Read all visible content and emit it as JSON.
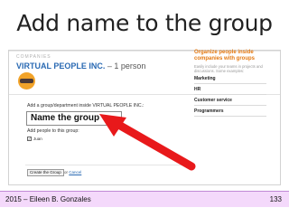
{
  "slide": {
    "title": "Add name to the group",
    "footer_left": "2015 – Eileen B. Gonzales",
    "footer_right": "133"
  },
  "screen": {
    "companies_label": "COMPANIES",
    "company_name": "VIRTUAL PEOPLE INC.",
    "company_count": " – 1 person",
    "form": {
      "add_label": "Add a group/department inside VIRTUAL PEOPLE INC.:",
      "name_value": "Name the group",
      "people_label": "Add people to this group:",
      "person": "Juan",
      "person_checked": true,
      "create_button": "Create the Group",
      "or_text": "or",
      "cancel_link": "Cancel"
    },
    "sidebar": {
      "title": "Organize people inside companies with groups",
      "description": "Easily include your teams in projects and discussions. Some examples:",
      "examples": [
        "Marketing",
        "HR",
        "Customer service",
        "Programmers"
      ]
    },
    "colors": {
      "link_blue": "#2a6ab3",
      "orange_accent": "#e47911",
      "arrow_red": "#e8191b",
      "footer_bg": "#f4d9fb",
      "logo_orange": "#f2a329"
    },
    "icons": {
      "arrow": "red-arrow-icon",
      "logo": "company-logo-icon",
      "checkbox": "checkbox-icon"
    }
  }
}
